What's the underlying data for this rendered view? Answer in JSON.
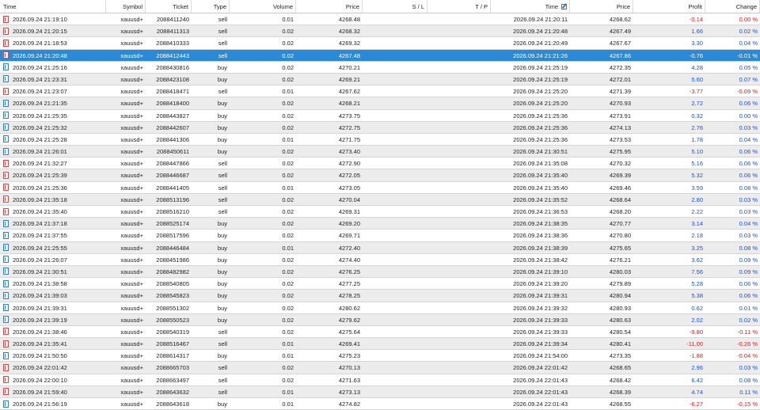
{
  "columns": {
    "time": "Time",
    "symbol": "Symbol",
    "ticket": "Ticket",
    "type": "Type",
    "volume": "Volume",
    "price": "Price",
    "sl": "S / L",
    "tp": "T / P",
    "close_time": "Time",
    "close_price": "Price",
    "profit": "Profit",
    "change": "Change"
  },
  "icons": {
    "buy": "buy-trade-icon",
    "sell": "sell-trade-icon",
    "edit": "edit-icon"
  },
  "colors": {
    "selected_row": "#2a8ad8",
    "positive": "#1f4fcc",
    "negative": "#d21f1f",
    "alt_row": "#ececec"
  },
  "selected_index": 3,
  "rows": [
    {
      "time": "2026.09.24 21:19:10",
      "symbol": "xauusd+",
      "ticket": "2088411240",
      "type": "sell",
      "volume": "0.01",
      "price": "4268.48",
      "sl": "",
      "tp": "",
      "close_time": "2026.09.24 21:20:11",
      "close_price": "4268.62",
      "profit": "-0.14",
      "change": "0.00 %",
      "neg": true
    },
    {
      "time": "2026.09.24 21:20:15",
      "symbol": "xauusd+",
      "ticket": "2088411313",
      "type": "sell",
      "volume": "0.02",
      "price": "4268.32",
      "sl": "",
      "tp": "",
      "close_time": "2026.09.24 21:20:48",
      "close_price": "4267.49",
      "profit": "1.66",
      "change": "0.02 %",
      "neg": false
    },
    {
      "time": "2026.09.24 21:18:53",
      "symbol": "xauusd+",
      "ticket": "2088410333",
      "type": "sell",
      "volume": "0.02",
      "price": "4269.32",
      "sl": "",
      "tp": "",
      "close_time": "2026.09.24 21:20:49",
      "close_price": "4267.67",
      "profit": "3.30",
      "change": "0.04 %",
      "neg": false
    },
    {
      "time": "2026.09.24 21:20:48",
      "symbol": "xauusd+",
      "ticket": "2088412443",
      "type": "sell",
      "volume": "0.02",
      "price": "4267.48",
      "sl": "",
      "tp": "",
      "close_time": "2026.09.24 21:21:26",
      "close_price": "4267.86",
      "profit": "-0.76",
      "change": "-0.01 %",
      "neg": true
    },
    {
      "time": "2026.09.24 21:25:16",
      "symbol": "xauusd+",
      "ticket": "2088430816",
      "type": "buy",
      "volume": "0.02",
      "price": "4270.21",
      "sl": "",
      "tp": "",
      "close_time": "2026.09.24 21:25:19",
      "close_price": "4272.35",
      "profit": "4.28",
      "change": "0.05 %",
      "neg": false
    },
    {
      "time": "2026.09.24 21:23:31",
      "symbol": "xauusd+",
      "ticket": "2088423108",
      "type": "buy",
      "volume": "0.02",
      "price": "4269.21",
      "sl": "",
      "tp": "",
      "close_time": "2026.09.24 21:25:19",
      "close_price": "4272.01",
      "profit": "5.60",
      "change": "0.07 %",
      "neg": false
    },
    {
      "time": "2026.09.24 21:23:07",
      "symbol": "xauusd+",
      "ticket": "2088418471",
      "type": "sell",
      "volume": "0.01",
      "price": "4267.62",
      "sl": "",
      "tp": "",
      "close_time": "2026.09.24 21:25:20",
      "close_price": "4271.39",
      "profit": "-3.77",
      "change": "-0.09 %",
      "neg": true
    },
    {
      "time": "2026.09.24 21:21:35",
      "symbol": "xauusd+",
      "ticket": "2088418400",
      "type": "buy",
      "volume": "0.02",
      "price": "4268.21",
      "sl": "",
      "tp": "",
      "close_time": "2026.09.24 21:25:20",
      "close_price": "4270.93",
      "profit": "2.72",
      "change": "0.06 %",
      "neg": false
    },
    {
      "time": "2026.09.24 21:25:35",
      "symbol": "xauusd+",
      "ticket": "2088443827",
      "type": "buy",
      "volume": "0.02",
      "price": "4273.75",
      "sl": "",
      "tp": "",
      "close_time": "2026.09.24 21:25:36",
      "close_price": "4273.91",
      "profit": "0.32",
      "change": "0.00 %",
      "neg": false
    },
    {
      "time": "2026.09.24 21:25:32",
      "symbol": "xauusd+",
      "ticket": "2088442607",
      "type": "buy",
      "volume": "0.02",
      "price": "4272.75",
      "sl": "",
      "tp": "",
      "close_time": "2026.09.24 21:25:36",
      "close_price": "4274.13",
      "profit": "2.76",
      "change": "0.03 %",
      "neg": false
    },
    {
      "time": "2026.09.24 21:25:28",
      "symbol": "xauusd+",
      "ticket": "2088441306",
      "type": "buy",
      "volume": "0.01",
      "price": "4271.75",
      "sl": "",
      "tp": "",
      "close_time": "2026.09.24 21:25:36",
      "close_price": "4273.53",
      "profit": "1.78",
      "change": "0.04 %",
      "neg": false
    },
    {
      "time": "2026.09.24 21:26:01",
      "symbol": "xauusd+",
      "ticket": "2088450611",
      "type": "buy",
      "volume": "0.02",
      "price": "4273.40",
      "sl": "",
      "tp": "",
      "close_time": "2026.09.24 21:30:51",
      "close_price": "4275.95",
      "profit": "5.10",
      "change": "0.06 %",
      "neg": false
    },
    {
      "time": "2026.09.24 21:32:27",
      "symbol": "xauusd+",
      "ticket": "2088447866",
      "type": "sell",
      "volume": "0.02",
      "price": "4272.90",
      "sl": "",
      "tp": "",
      "close_time": "2026.09.24 21:35:08",
      "close_price": "4270.32",
      "profit": "5.16",
      "change": "0.06 %",
      "neg": false
    },
    {
      "time": "2026.09.24 21:25:39",
      "symbol": "xauusd+",
      "ticket": "2088446687",
      "type": "sell",
      "volume": "0.02",
      "price": "4272.05",
      "sl": "",
      "tp": "",
      "close_time": "2026.09.24 21:35:40",
      "close_price": "4269.39",
      "profit": "5.32",
      "change": "0.06 %",
      "neg": false
    },
    {
      "time": "2026.09.24 21:25:36",
      "symbol": "xauusd+",
      "ticket": "2088441405",
      "type": "sell",
      "volume": "0.01",
      "price": "4273.05",
      "sl": "",
      "tp": "",
      "close_time": "2026.09.24 21:35:40",
      "close_price": "4269.46",
      "profit": "3.59",
      "change": "0.08 %",
      "neg": false
    },
    {
      "time": "2026.09.24 21:35:18",
      "symbol": "xauusd+",
      "ticket": "2088513196",
      "type": "sell",
      "volume": "0.02",
      "price": "4270.04",
      "sl": "",
      "tp": "",
      "close_time": "2026.09.24 21:35:52",
      "close_price": "4268.64",
      "profit": "2.80",
      "change": "0.03 %",
      "neg": false
    },
    {
      "time": "2026.09.24 21:35:40",
      "symbol": "xauusd+",
      "ticket": "2088516210",
      "type": "sell",
      "volume": "0.02",
      "price": "4269.31",
      "sl": "",
      "tp": "",
      "close_time": "2026.09.24 21:36:53",
      "close_price": "4268.20",
      "profit": "2.22",
      "change": "0.03 %",
      "neg": false
    },
    {
      "time": "2026.09.24 21:37:18",
      "symbol": "xauusd+",
      "ticket": "2088525174",
      "type": "buy",
      "volume": "0.02",
      "price": "4269.20",
      "sl": "",
      "tp": "",
      "close_time": "2026.09.24 21:38:35",
      "close_price": "4270.77",
      "profit": "3.14",
      "change": "0.04 %",
      "neg": false
    },
    {
      "time": "2026.09.24 21:37:55",
      "symbol": "xauusd+",
      "ticket": "2088517596",
      "type": "buy",
      "volume": "0.02",
      "price": "4269.71",
      "sl": "",
      "tp": "",
      "close_time": "2026.09.24 21:38:36",
      "close_price": "4270.80",
      "profit": "2.18",
      "change": "0.03 %",
      "neg": false
    },
    {
      "time": "2026.09.24 21:25:55",
      "symbol": "xauusd+",
      "ticket": "2088446484",
      "type": "buy",
      "volume": "0.01",
      "price": "4272.40",
      "sl": "",
      "tp": "",
      "close_time": "2026.09.24 21:38:39",
      "close_price": "4275.65",
      "profit": "3.25",
      "change": "0.08 %",
      "neg": false
    },
    {
      "time": "2026.09.24 21:26:07",
      "symbol": "xauusd+",
      "ticket": "2088451986",
      "type": "buy",
      "volume": "0.02",
      "price": "4274.40",
      "sl": "",
      "tp": "",
      "close_time": "2026.09.24 21:38:42",
      "close_price": "4276.21",
      "profit": "3.62",
      "change": "0.09 %",
      "neg": false
    },
    {
      "time": "2026.09.24 21:30:51",
      "symbol": "xauusd+",
      "ticket": "2088482982",
      "type": "buy",
      "volume": "0.02",
      "price": "4276.25",
      "sl": "",
      "tp": "",
      "close_time": "2026.09.24 21:39:10",
      "close_price": "4280.03",
      "profit": "7.56",
      "change": "0.09 %",
      "neg": false
    },
    {
      "time": "2026.09.24 21:38:58",
      "symbol": "xauusd+",
      "ticket": "2088540805",
      "type": "buy",
      "volume": "0.02",
      "price": "4277.25",
      "sl": "",
      "tp": "",
      "close_time": "2026.09.24 21:39:20",
      "close_price": "4279.89",
      "profit": "5.28",
      "change": "0.06 %",
      "neg": false
    },
    {
      "time": "2026.09.24 21:39:03",
      "symbol": "xauusd+",
      "ticket": "2088545823",
      "type": "buy",
      "volume": "0.02",
      "price": "4278.25",
      "sl": "",
      "tp": "",
      "close_time": "2026.09.24 21:39:31",
      "close_price": "4280.94",
      "profit": "5.38",
      "change": "0.06 %",
      "neg": false
    },
    {
      "time": "2026.09.24 21:39:31",
      "symbol": "xauusd+",
      "ticket": "2088551302",
      "type": "buy",
      "volume": "0.02",
      "price": "4280.62",
      "sl": "",
      "tp": "",
      "close_time": "2026.09.24 21:39:32",
      "close_price": "4280.93",
      "profit": "0.62",
      "change": "0.01 %",
      "neg": false
    },
    {
      "time": "2026.09.24 21:39:19",
      "symbol": "xauusd+",
      "ticket": "2088550523",
      "type": "buy",
      "volume": "0.02",
      "price": "4279.62",
      "sl": "",
      "tp": "",
      "close_time": "2026.09.24 21:39:33",
      "close_price": "4280.63",
      "profit": "2.02",
      "change": "0.02 %",
      "neg": false
    },
    {
      "time": "2026.09.24 21:38:46",
      "symbol": "xauusd+",
      "ticket": "2088540319",
      "type": "sell",
      "volume": "0.02",
      "price": "4275.64",
      "sl": "",
      "tp": "",
      "close_time": "2026.09.24 21:39:33",
      "close_price": "4280.54",
      "profit": "-9.80",
      "change": "-0.11 %",
      "neg": true
    },
    {
      "time": "2026.09.24 21:35:41",
      "symbol": "xauusd+",
      "ticket": "2088516467",
      "type": "sell",
      "volume": "0.01",
      "price": "4269.41",
      "sl": "",
      "tp": "",
      "close_time": "2026.09.24 21:39:34",
      "close_price": "4280.41",
      "profit": "-11.00",
      "change": "-0.26 %",
      "neg": true
    },
    {
      "time": "2026.09.24 21:50:50",
      "symbol": "xauusd+",
      "ticket": "2088614317",
      "type": "buy",
      "volume": "0.01",
      "price": "4275.23",
      "sl": "",
      "tp": "",
      "close_time": "2026.09.24 21:54:00",
      "close_price": "4273.35",
      "profit": "-1.88",
      "change": "-0.04 %",
      "neg": true
    },
    {
      "time": "2026.09.24 22:01:42",
      "symbol": "xauusd+",
      "ticket": "2088665703",
      "type": "sell",
      "volume": "0.02",
      "price": "4270.13",
      "sl": "",
      "tp": "",
      "close_time": "2026.09.24 22:01:42",
      "close_price": "4268.65",
      "profit": "2.96",
      "change": "0.03 %",
      "neg": false
    },
    {
      "time": "2026.09.24 22:00:10",
      "symbol": "xauusd+",
      "ticket": "2088663497",
      "type": "sell",
      "volume": "0.02",
      "price": "4271.63",
      "sl": "",
      "tp": "",
      "close_time": "2026.09.24 22:01:43",
      "close_price": "4268.42",
      "profit": "6.42",
      "change": "0.08 %",
      "neg": false
    },
    {
      "time": "2026.09.24 21:59:40",
      "symbol": "xauusd+",
      "ticket": "2088643632",
      "type": "sell",
      "volume": "0.01",
      "price": "4273.13",
      "sl": "",
      "tp": "",
      "close_time": "2026.09.24 22:01:43",
      "close_price": "4268.39",
      "profit": "4.74",
      "change": "0.11 %",
      "neg": false
    },
    {
      "time": "2026.09.24 21:56:19",
      "symbol": "xauusd+",
      "ticket": "2088643618",
      "type": "buy",
      "volume": "0.01",
      "price": "4274.82",
      "sl": "",
      "tp": "",
      "close_time": "2026.09.24 22:01:43",
      "close_price": "4268.55",
      "profit": "-6.27",
      "change": "-0.15 %",
      "neg": true
    }
  ]
}
